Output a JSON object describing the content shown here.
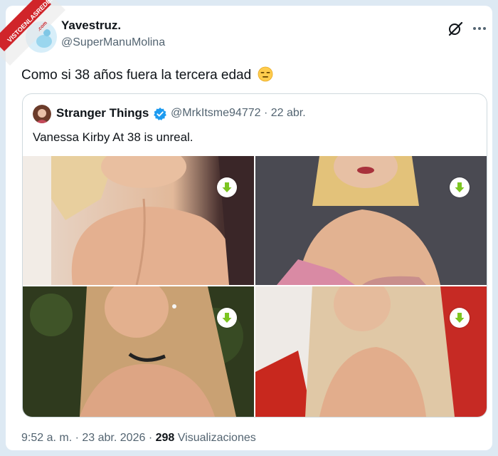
{
  "watermark": {
    "text": "VISTOENLASREDES",
    "sub": ".com"
  },
  "author": {
    "name": "Yavestruz.",
    "handle": "@SuperManuMolina"
  },
  "icons": {
    "grok": "grok-icon",
    "more": "more-icon",
    "verified": "verified-badge-icon",
    "download": "download-icon"
  },
  "tweet": {
    "text": "Como si 38 años fuera la tercera edad",
    "emoji": "expressionless-face-emoji"
  },
  "quote": {
    "name": "Stranger Things",
    "handle": "@MrkItsme94772",
    "separator": "·",
    "date": "22 abr.",
    "text": "Vanessa Kirby At 38 is unreal.",
    "media": [
      {
        "description": "photo 1"
      },
      {
        "description": "photo 2"
      },
      {
        "description": "photo 3"
      },
      {
        "description": "photo 4"
      }
    ]
  },
  "footer": {
    "time": "9:52 a. m.",
    "separator": "·",
    "date": "23 abr. 2026",
    "separator2": "·",
    "views_count": "298",
    "views_label": "Visualizaciones"
  },
  "colors": {
    "accent": "#1d9bf0",
    "download": "#7cc521",
    "text": "#0f1419",
    "muted": "#536471",
    "background": "#dde9f3"
  }
}
